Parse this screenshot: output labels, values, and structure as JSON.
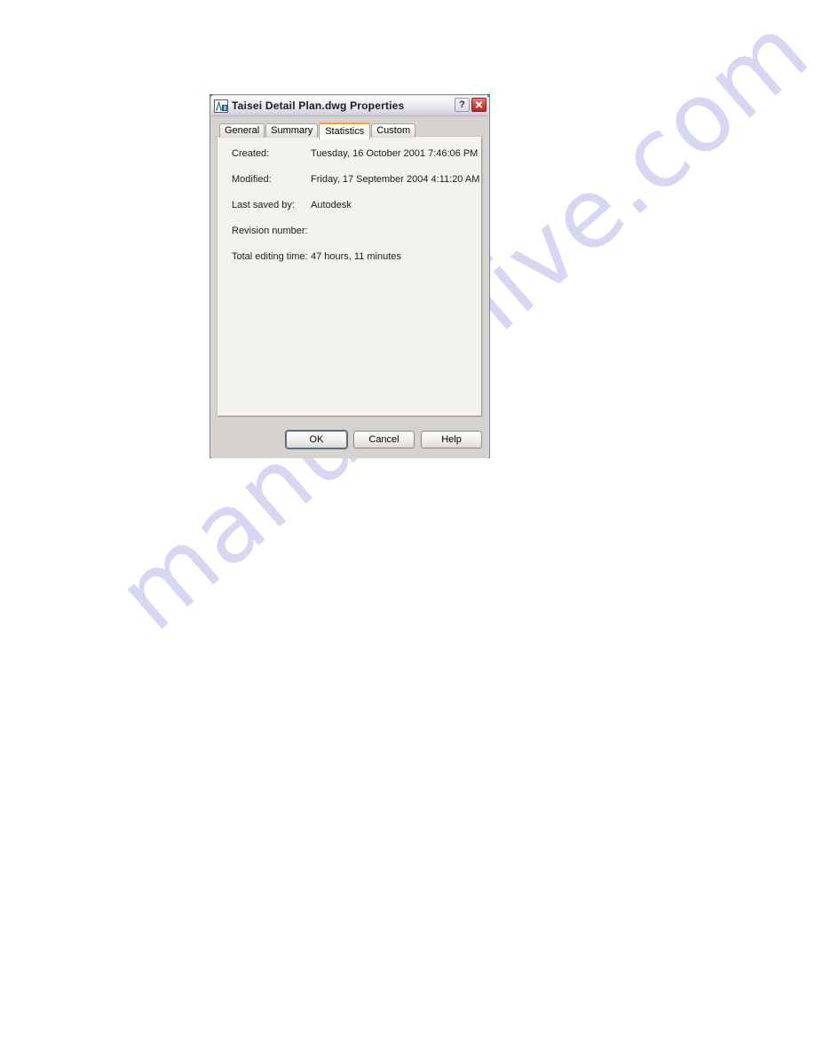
{
  "page": {
    "background_color": "#ffffff",
    "watermark": {
      "text": "manualshive.com",
      "color": "#c9c7ef"
    }
  },
  "dialog": {
    "title": "Taisei Detail Plan.dwg Properties",
    "icon": "autocad-drawing-icon",
    "caption_buttons": {
      "help": "?",
      "close": "✕"
    },
    "tabs": [
      {
        "label": "General",
        "active": false
      },
      {
        "label": "Summary",
        "active": false
      },
      {
        "label": "Statistics",
        "active": true
      },
      {
        "label": "Custom",
        "active": false
      }
    ],
    "active_tab_accent_color": "#f0a22e",
    "statistics": {
      "rows": [
        {
          "label": "Created:",
          "value": "Tuesday, 16 October 2001  7:46:06 PM"
        },
        {
          "label": "Modified:",
          "value": "Friday, 17 September 2004  4:11:20 AM"
        },
        {
          "label": "Last saved by:",
          "value": "Autodesk"
        },
        {
          "label": "Revision number:",
          "value": ""
        },
        {
          "label": "Total editing time:",
          "value": "47 hours, 11 minutes"
        }
      ]
    },
    "buttons": {
      "ok": "OK",
      "cancel": "Cancel",
      "help": "Help"
    }
  }
}
